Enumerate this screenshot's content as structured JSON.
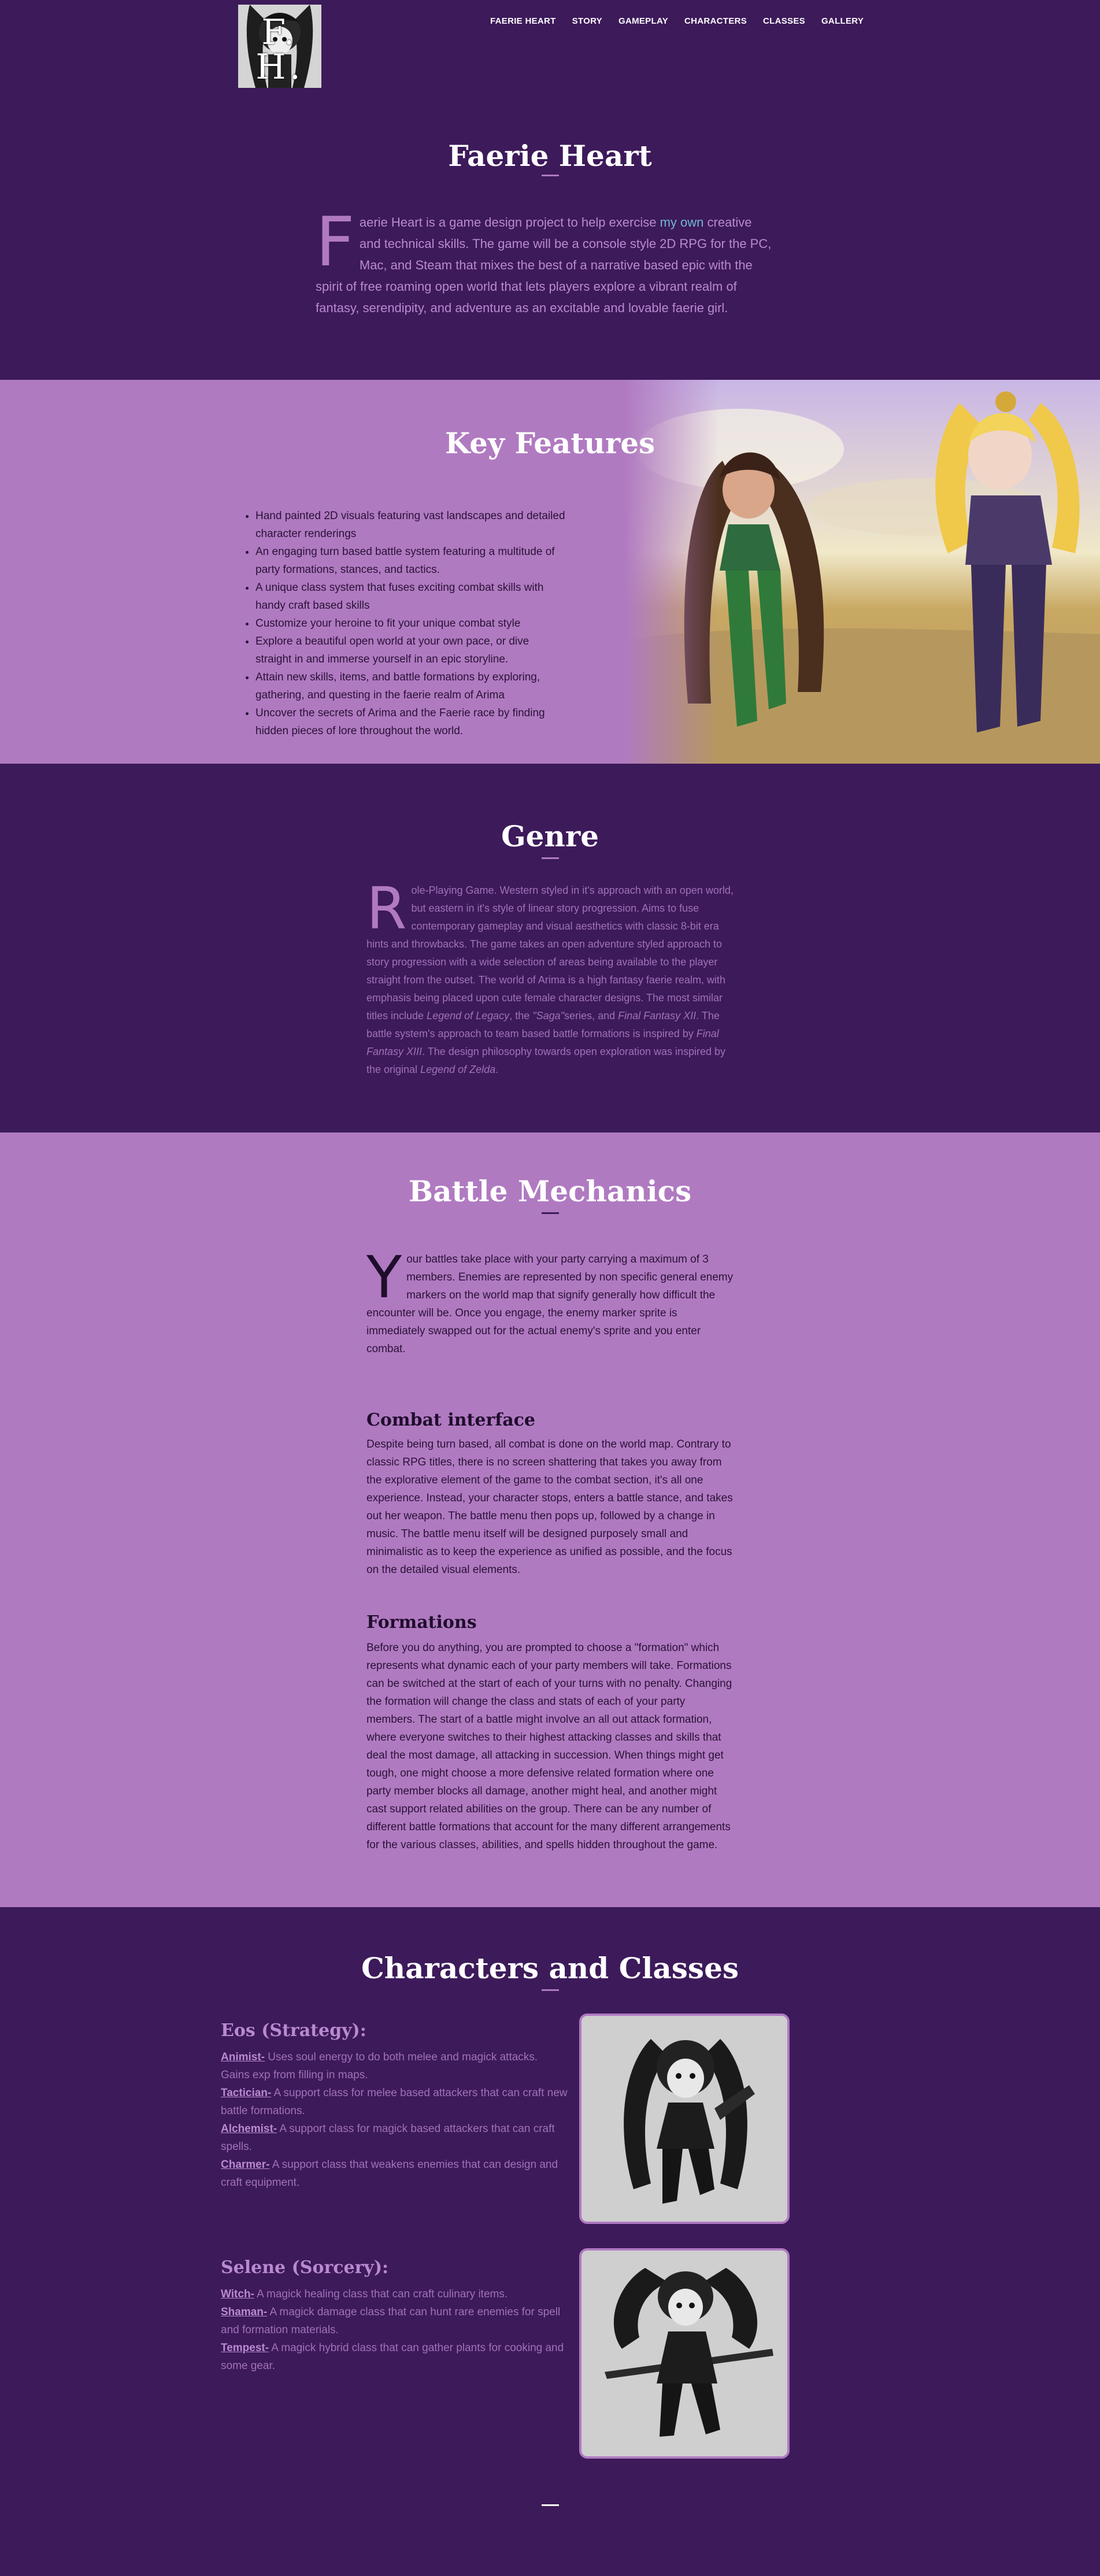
{
  "nav": {
    "logo_alt": "F. H.",
    "items": [
      "FAERIE HEART",
      "STORY",
      "GAMEPLAY",
      "CHARACTERS",
      "CLASSES",
      "GALLERY"
    ]
  },
  "hero": {
    "title": "Faerie Heart",
    "dropcap": "F",
    "text_before_link": "aerie Heart is a game design project to help exercise ",
    "link": "my own",
    "text_after_link": " creative and technical skills. The game will be a console style 2D RPG for the PC, Mac, and Steam that mixes the best of a narrative based epic with the spirit of free roaming open world that lets players explore a vibrant realm of fantasy, serendipity, and adventure as an excitable and lovable faerie girl."
  },
  "features": {
    "title": "Key Features",
    "items": [
      "Hand painted 2D visuals featuring vast landscapes and detailed character renderings",
      "An engaging turn based battle system featuring a multitude of party formations, stances, and tactics.",
      "A unique class system that fuses exciting combat skills with handy craft based skills",
      "Customize your heroine to fit your unique combat style",
      "Explore a beautiful open world at your own pace, or dive straight in and immerse yourself in an epic storyline.",
      "Attain new skills, items, and battle formations by exploring, gathering, and questing in the faerie realm of Arima",
      "Uncover the secrets of Arima and the Faerie race by finding hidden pieces of lore throughout the world."
    ]
  },
  "genre": {
    "title": "Genre",
    "dropcap": "R",
    "p1": "ole-Playing Game. Western styled in it's approach with an open world, but eastern in it's style of linear story progression. Aims to fuse contemporary gameplay and visual aesthetics with classic 8-bit era hints and throwbacks. The game takes an open adventure styled approach to story progression with a wide selection of areas being available to the player straight from the outset. The world of Arima is a high fantasy faerie realm, with emphasis being placed upon cute female character designs. The most similar titles include ",
    "i1": "Legend of Legacy",
    "p2": ", the ",
    "i2": "\"Saga\"",
    "p3": "series, and ",
    "i3": "Final Fantasy XII",
    "p4": ". The battle system's approach to team based battle formations is inspired by ",
    "i4": "Final Fantasy XIII",
    "p5": ". The design philosophy towards open exploration was inspired by the original ",
    "i5": "Legend of Zelda",
    "p6": "."
  },
  "battle": {
    "title": "Battle Mechanics",
    "dropcap": "Y",
    "intro": "our battles take place with your party carrying a maximum of 3 members. Enemies are represented by non specific general enemy markers on the world map that signify generally how difficult the encounter will be. Once you engage, the enemy marker sprite is immediately swapped out for the actual enemy's sprite and you enter combat.",
    "combat_heading": "Combat interface",
    "combat_text": "Despite being turn based, all combat is done on the world map. Contrary to classic RPG titles, there is no screen shattering that takes you away from the explorative element of the game to the combat section, it's all one experience. Instead, your character stops, enters a battle stance, and takes out her weapon. The battle menu then pops up, followed by a change in music. The battle menu itself will be designed purposely small and minimalistic as to keep the experience as unified as possible, and the focus on the detailed visual elements.",
    "formations_heading": "Formations",
    "formations_text": "Before you do anything, you are prompted to choose a \"formation\" which represents what dynamic each of your party members will take. Formations can be switched at the start of each of your turns with no penalty. Changing the formation will change the class and stats of each of your party members. The start of a battle might involve an all out attack formation, where everyone switches to their highest attacking classes and skills that deal the most damage, all attacking in succession. When things might get tough, one might choose a more defensive related formation where one party member blocks all damage, another might heal, and another might cast support related abilities on the group. There can be any number of different battle formations that account for the many different arrangements for the various classes, abilities, and spells hidden throughout the game."
  },
  "characters": {
    "title": "Characters and Classes",
    "eos": {
      "name": "Eos (Strategy):",
      "classes": [
        {
          "name": "Animist-",
          "desc": " Uses soul energy to do both melee and magick attacks. Gains exp from filling in maps."
        },
        {
          "name": "Tactician-",
          "desc": " A support class for melee based attackers that can craft new battle formations."
        },
        {
          "name": "Alchemist-",
          "desc": " A support class for magick based attackers that can craft spells."
        },
        {
          "name": "Charmer-",
          "desc": " A support class that weakens enemies that can design and craft equipment."
        }
      ]
    },
    "selene": {
      "name": "Selene (Sorcery):",
      "classes": [
        {
          "name": "Witch-",
          "desc": " A magick healing class that can craft culinary items."
        },
        {
          "name": "Shaman-",
          "desc": " A magick damage class that can hunt rare enemies for spell and formation materials."
        },
        {
          "name": "Tempest-",
          "desc": " A magick hybrid class that can gather plants for cooking and some gear."
        }
      ]
    }
  },
  "colors": {
    "dark_purple": "#3d1a5a",
    "light_purple": "#b07ac1",
    "link_blue": "#6fb7d6"
  }
}
